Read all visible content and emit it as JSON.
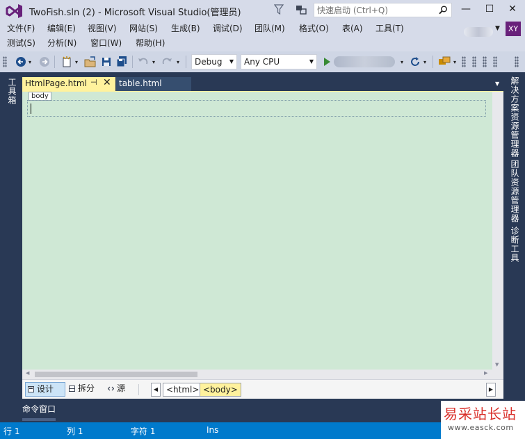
{
  "window": {
    "title": "TwoFish.sln (2) - Microsoft Visual Studio(管理员)",
    "quick_launch_placeholder": "快速启动 (Ctrl+Q)",
    "controls": {
      "minimize": "—",
      "maximize": "☐",
      "close": "✕"
    }
  },
  "menu": {
    "items": [
      "文件(F)",
      "编辑(E)",
      "视图(V)",
      "网站(S)",
      "生成(B)",
      "调试(D)",
      "团队(M)",
      "格式(O)",
      "表(A)",
      "工具(T)",
      "测试(S)",
      "分析(N)",
      "窗口(W)",
      "帮助(H)"
    ],
    "user_initials": "XY"
  },
  "toolbar": {
    "configuration": "Debug",
    "platform": "Any CPU",
    "icons": [
      "back-icon",
      "forward-icon",
      "new-project-icon",
      "open-file-icon",
      "save-icon",
      "save-all-icon",
      "undo-icon",
      "redo-icon",
      "start-icon",
      "refresh-icon",
      "browser-link-icon"
    ]
  },
  "left_rail": {
    "label": "工具箱"
  },
  "right_rail": {
    "labels": [
      "解决方案资源管理器",
      "团队资源管理器",
      "诊断工具"
    ]
  },
  "tabs": [
    {
      "label": "HtmlPage.html",
      "active": true,
      "pin_glyph": "⊣",
      "close_glyph": "✕"
    },
    {
      "label": "table.html",
      "active": false
    }
  ],
  "designer": {
    "body_tag": "body",
    "colors": {
      "canvas": "#cfe8d5",
      "accent": "#fff29d"
    }
  },
  "view_bar": {
    "design": "设计",
    "split": "拆分",
    "source": "源",
    "breadcrumbs": [
      "<html>",
      "<body>"
    ]
  },
  "bottom_panel": {
    "tab": "命令窗口"
  },
  "status": {
    "line": "行 1",
    "col": "列 1",
    "char": "字符 1",
    "mode": "Ins"
  },
  "watermark": {
    "cn": "易采站长站",
    "en": "www.easck.com"
  }
}
